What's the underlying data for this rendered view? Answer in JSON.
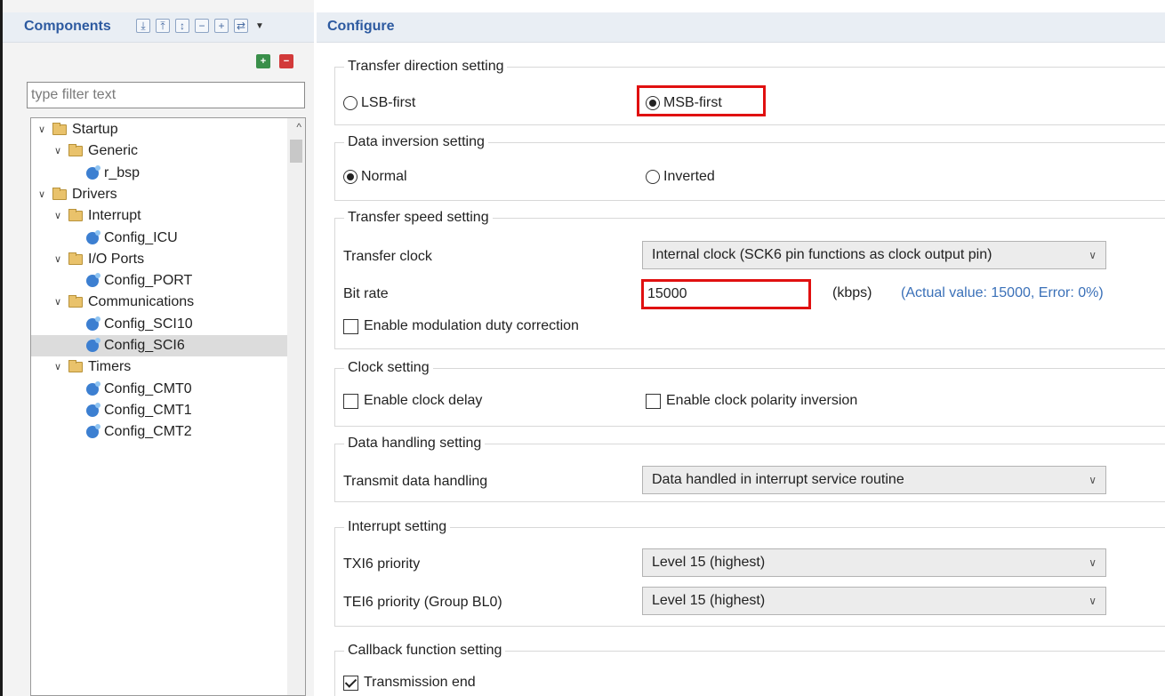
{
  "components_panel": {
    "title": "Components",
    "filter_placeholder": "type filter text",
    "tree": [
      {
        "label": "Startup",
        "type": "folder",
        "depth": 0,
        "expanded": true
      },
      {
        "label": "Generic",
        "type": "folder",
        "depth": 1,
        "expanded": true
      },
      {
        "label": "r_bsp",
        "type": "component",
        "depth": 2
      },
      {
        "label": "Drivers",
        "type": "folder",
        "depth": 0,
        "expanded": true
      },
      {
        "label": "Interrupt",
        "type": "folder",
        "depth": 1,
        "expanded": true
      },
      {
        "label": "Config_ICU",
        "type": "component",
        "depth": 2
      },
      {
        "label": "I/O Ports",
        "type": "folder",
        "depth": 1,
        "expanded": true
      },
      {
        "label": "Config_PORT",
        "type": "component",
        "depth": 2
      },
      {
        "label": "Communications",
        "type": "folder",
        "depth": 1,
        "expanded": true
      },
      {
        "label": "Config_SCI10",
        "type": "component",
        "depth": 2
      },
      {
        "label": "Config_SCI6",
        "type": "component",
        "depth": 2,
        "selected": true
      },
      {
        "label": "Timers",
        "type": "folder",
        "depth": 1,
        "expanded": true
      },
      {
        "label": "Config_CMT0",
        "type": "component",
        "depth": 2
      },
      {
        "label": "Config_CMT1",
        "type": "component",
        "depth": 2
      },
      {
        "label": "Config_CMT2",
        "type": "component",
        "depth": 2
      }
    ]
  },
  "configure_panel": {
    "title": "Configure",
    "transfer_direction": {
      "title": "Transfer direction setting",
      "lsb_label": "LSB-first",
      "msb_label": "MSB-first",
      "selected": "MSB-first"
    },
    "data_inversion": {
      "title": "Data inversion setting",
      "normal_label": "Normal",
      "inverted_label": "Inverted",
      "selected": "Normal"
    },
    "transfer_speed": {
      "title": "Transfer speed setting",
      "transfer_clock_label": "Transfer clock",
      "transfer_clock_value": "Internal clock (SCK6 pin functions as clock output pin)",
      "bit_rate_label": "Bit rate",
      "bit_rate_value": "15000",
      "bit_rate_unit": "(kbps)",
      "actual_value": "(Actual value: 15000, Error: 0%)",
      "modulation_label": "Enable modulation duty correction",
      "modulation_checked": false
    },
    "clock_setting": {
      "title": "Clock setting",
      "delay_label": "Enable clock delay",
      "delay_checked": false,
      "polarity_label": "Enable clock polarity inversion",
      "polarity_checked": false
    },
    "data_handling": {
      "title": "Data handling setting",
      "transmit_label": "Transmit data handling",
      "transmit_value": "Data handled in interrupt service routine"
    },
    "interrupt_setting": {
      "title": "Interrupt setting",
      "txi_label": "TXI6 priority",
      "txi_value": "Level 15 (highest)",
      "tei_label": "TEI6 priority (Group BL0)",
      "tei_value": "Level 15 (highest)"
    },
    "callback": {
      "title": "Callback function setting",
      "transmission_end_label": "Transmission end",
      "transmission_end_checked": true
    }
  },
  "colors": {
    "header_title": "#2d5aa0",
    "highlight_red": "#e01010",
    "actual_value_blue": "#3a70b8"
  }
}
